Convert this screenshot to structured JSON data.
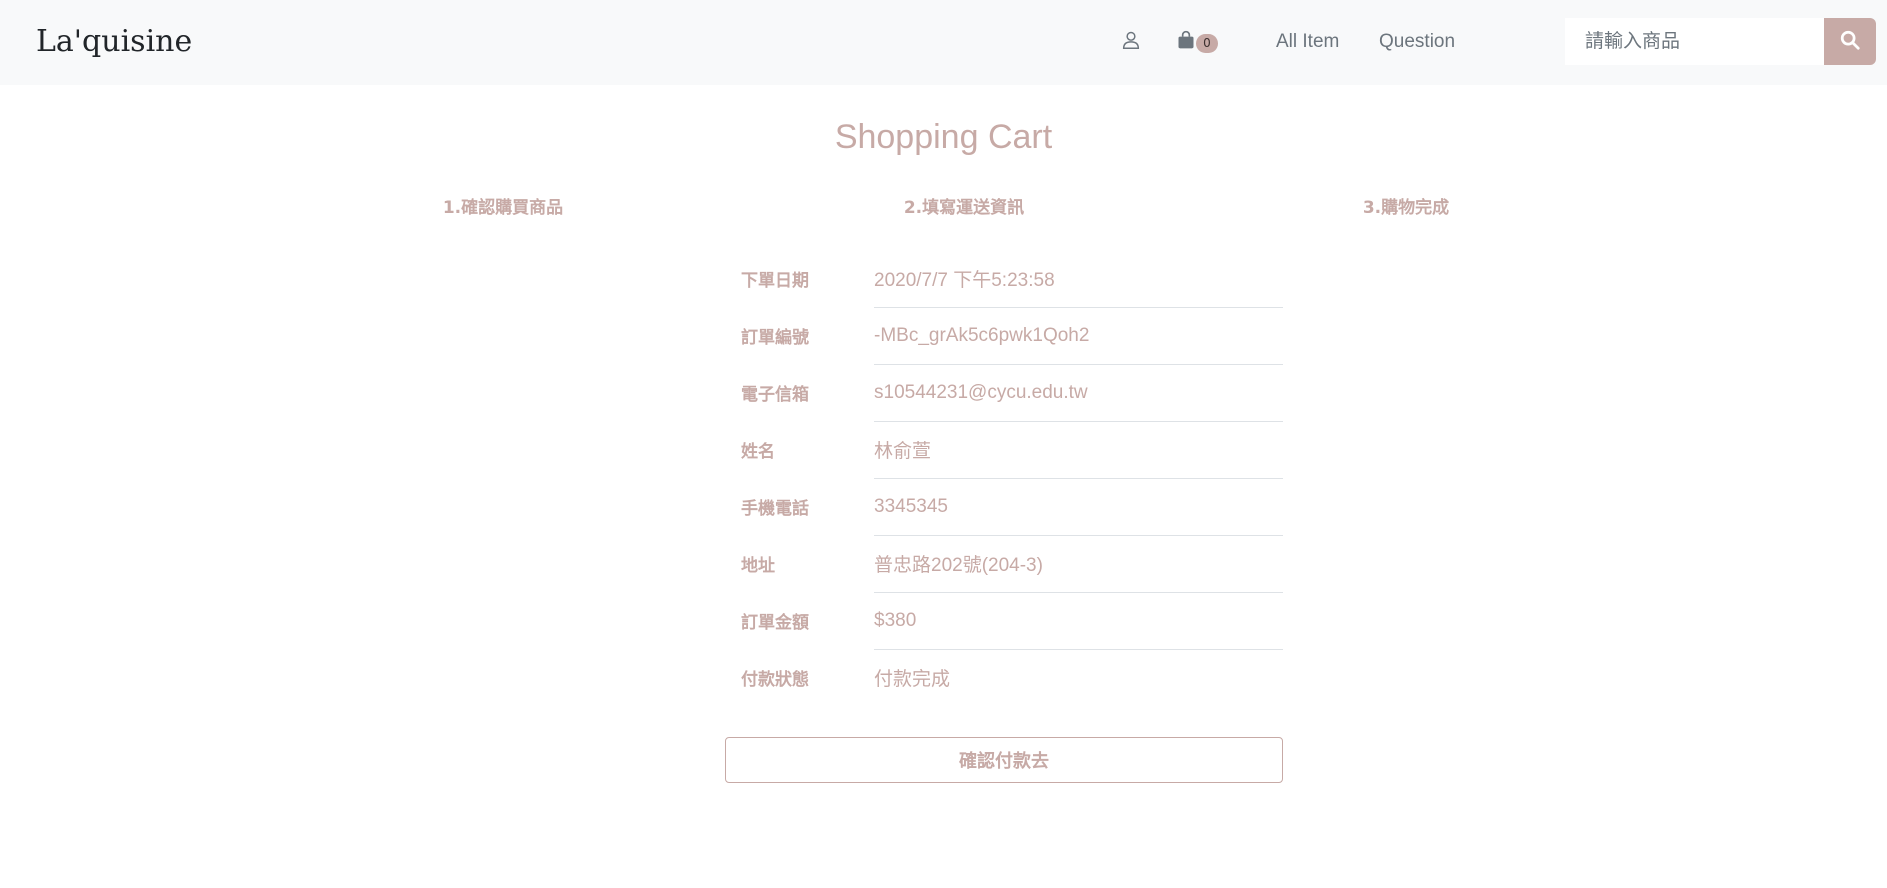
{
  "navbar": {
    "brand": "La'quisine",
    "icons": {
      "user": "user-icon",
      "cart": "shopping-bag-icon",
      "search": "search-icon"
    },
    "cart_count": "0",
    "links": [
      "All Item",
      "Question"
    ],
    "search": {
      "placeholder": "請輸入商品",
      "value": ""
    }
  },
  "page": {
    "title": "Shopping Cart",
    "steps": [
      "1.確認購買商品",
      "2.填寫運送資訊",
      "3.購物完成"
    ]
  },
  "order": {
    "rows": [
      {
        "label": "下單日期",
        "value": "2020/7/7 下午5:23:58"
      },
      {
        "label": "訂單編號",
        "value": "-MBc_grAk5c6pwk1Qoh2"
      },
      {
        "label": "電子信箱",
        "value": "s10544231@cycu.edu.tw"
      },
      {
        "label": "姓名",
        "value": "林俞萱"
      },
      {
        "label": "手機電話",
        "value": "3345345"
      },
      {
        "label": "地址",
        "value": "普忠路202號(204-3)"
      },
      {
        "label": "訂單金額",
        "value": "$380"
      },
      {
        "label": "付款狀態",
        "value": "付款完成"
      }
    ],
    "confirm_label": "確認付款去"
  },
  "colors": {
    "accent": "#c7aaa6",
    "navbar_bg": "#f8f9fa",
    "divider": "#dee2e6"
  }
}
